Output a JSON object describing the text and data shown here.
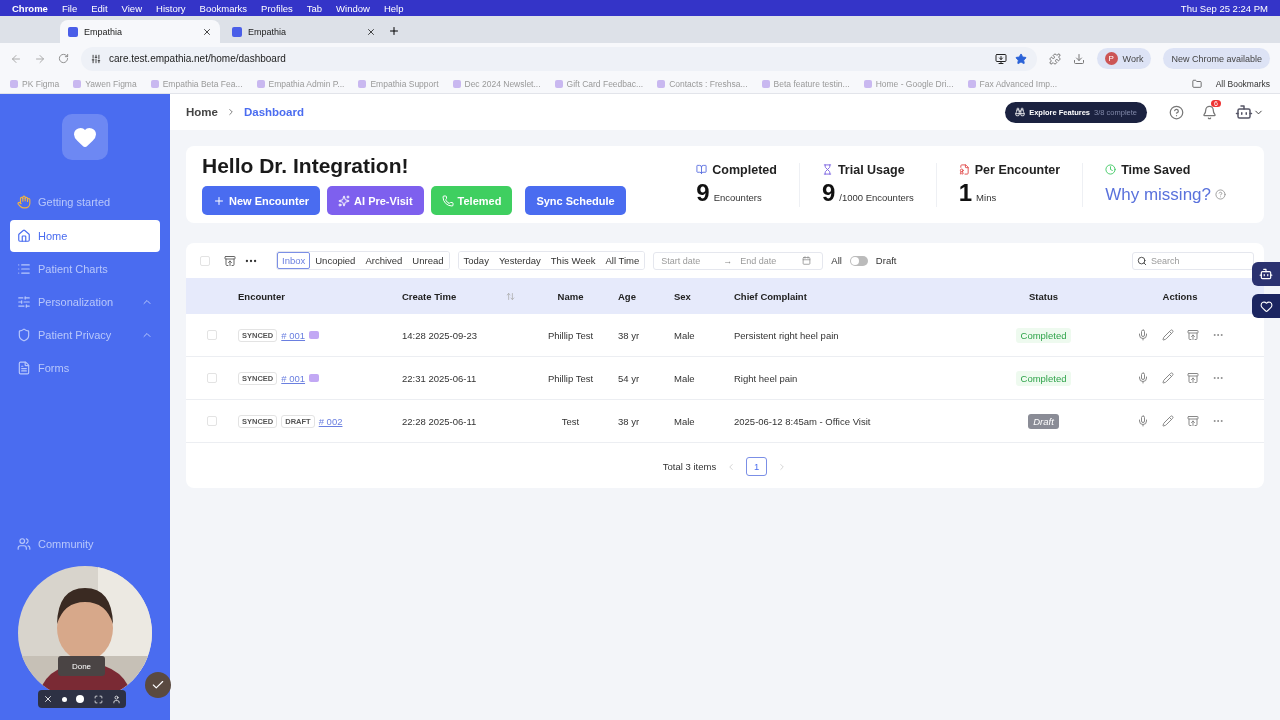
{
  "menu_bar": {
    "app": "Chrome",
    "items": [
      "File",
      "Edit",
      "View",
      "History",
      "Bookmarks",
      "Profiles",
      "Tab",
      "Window",
      "Help"
    ],
    "clock": "Thu Sep 25  2:24 PM"
  },
  "browser": {
    "tabs": [
      {
        "title": "Empathia",
        "selected": true
      },
      {
        "title": "Empathia",
        "selected": false
      }
    ],
    "url": "care.test.empathia.net/home/dashboard",
    "profile": "Work",
    "profile_initial": "P",
    "update": "New Chrome available",
    "bookmarks": [
      "PK Figma",
      "Yawen Figma",
      "Empathia Beta Fea...",
      "Empathia Admin P...",
      "Empathia Support",
      "Dec 2024 Newslet...",
      "Gift Card Feedbac...",
      "Contacts : Freshsa...",
      "Beta feature testin...",
      "Home - Google Dri...",
      "Fax Advanced Imp..."
    ],
    "all_bookmarks": "All Bookmarks"
  },
  "sidebar": {
    "items": [
      {
        "label": "Getting started",
        "kind": "wave",
        "selected": false,
        "expandable": false
      },
      {
        "label": "Home",
        "kind": "home",
        "selected": true,
        "expandable": false
      },
      {
        "label": "Patient Charts",
        "kind": "list",
        "selected": false,
        "expandable": false
      },
      {
        "label": "Personalization",
        "kind": "sliders",
        "selected": false,
        "expandable": true
      },
      {
        "label": "Patient Privacy",
        "kind": "shield",
        "selected": false,
        "expandable": true
      },
      {
        "label": "Forms",
        "kind": "form",
        "selected": false,
        "expandable": false
      }
    ],
    "bottom_items": [
      {
        "label": "Community",
        "kind": "users"
      }
    ]
  },
  "breadcrumb": [
    "Home",
    "Dashboard"
  ],
  "explore": {
    "label": "Explore Features",
    "progress": "3/8 complete"
  },
  "notifications": "6",
  "greeting": "Hello Dr. Integration!",
  "actions": [
    {
      "label": "New Encounter",
      "kind": "new"
    },
    {
      "label": "AI Pre-Visit",
      "kind": "ai"
    },
    {
      "label": "Telemed",
      "kind": "phone"
    },
    {
      "label": "Sync Schedule",
      "kind": "sync"
    }
  ],
  "stats": [
    {
      "title": "Completed",
      "kind": "book",
      "value": "9",
      "unit": "Encounters"
    },
    {
      "title": "Trial Usage",
      "kind": "hourglass",
      "value": "9",
      "unit": "/1000 Encounters"
    },
    {
      "title": "Per Encounter",
      "kind": "doc",
      "value": "1",
      "unit": "Mins"
    },
    {
      "title": "Time Saved",
      "kind": "clock",
      "link": "Why missing?"
    }
  ],
  "filters": {
    "all_checked": false,
    "folders": [
      {
        "label": "Inbox",
        "selected": true
      },
      {
        "label": "Uncopied",
        "selected": false
      },
      {
        "label": "Archived",
        "selected": false
      },
      {
        "label": "Unread",
        "selected": false
      }
    ],
    "periods": [
      {
        "label": "Today",
        "selected": false
      },
      {
        "label": "Yesterday",
        "selected": false
      },
      {
        "label": "This Week",
        "selected": false
      },
      {
        "label": "All Time",
        "selected": false
      }
    ],
    "start_placeholder": "Start date",
    "date_separator": "→",
    "end_placeholder": "End date",
    "toggle_left": "All",
    "toggle_right": "Draft",
    "draft_on": false,
    "search_placeholder": "Search"
  },
  "table": {
    "columns": [
      "Encounter",
      "Create Time",
      "Name",
      "Age",
      "Sex",
      "Chief Complaint",
      "Status",
      "Actions"
    ],
    "rows": [
      {
        "checked": false,
        "tags": [
          "SYNCED"
        ],
        "id": "# 001",
        "ai_badge": true,
        "time": "14:28 2025-09-23",
        "name": "Phillip Test",
        "age": "38 yr",
        "sex": "Male",
        "complaint": "Persistent right heel pain",
        "status": "Completed",
        "kind": "completed"
      },
      {
        "checked": false,
        "tags": [
          "SYNCED"
        ],
        "id": "# 001",
        "ai_badge": true,
        "time": "22:31 2025-06-11",
        "name": "Phillip Test",
        "age": "54 yr",
        "sex": "Male",
        "complaint": "Right heel pain",
        "status": "Completed",
        "kind": "completed"
      },
      {
        "checked": false,
        "tags": [
          "SYNCED",
          "DRAFT"
        ],
        "id": "# 002",
        "ai_badge": false,
        "time": "22:28 2025-06-11",
        "name": "Test",
        "age": "38 yr",
        "sex": "Male",
        "complaint": "2025-06-12 8:45am - Office Visit",
        "status": "Draft",
        "kind": "draft"
      }
    ]
  },
  "pagination": {
    "total": "Total 3 items",
    "pages": [
      {
        "label": "1",
        "selected": true
      }
    ]
  },
  "webcam": {
    "done": "Done"
  }
}
